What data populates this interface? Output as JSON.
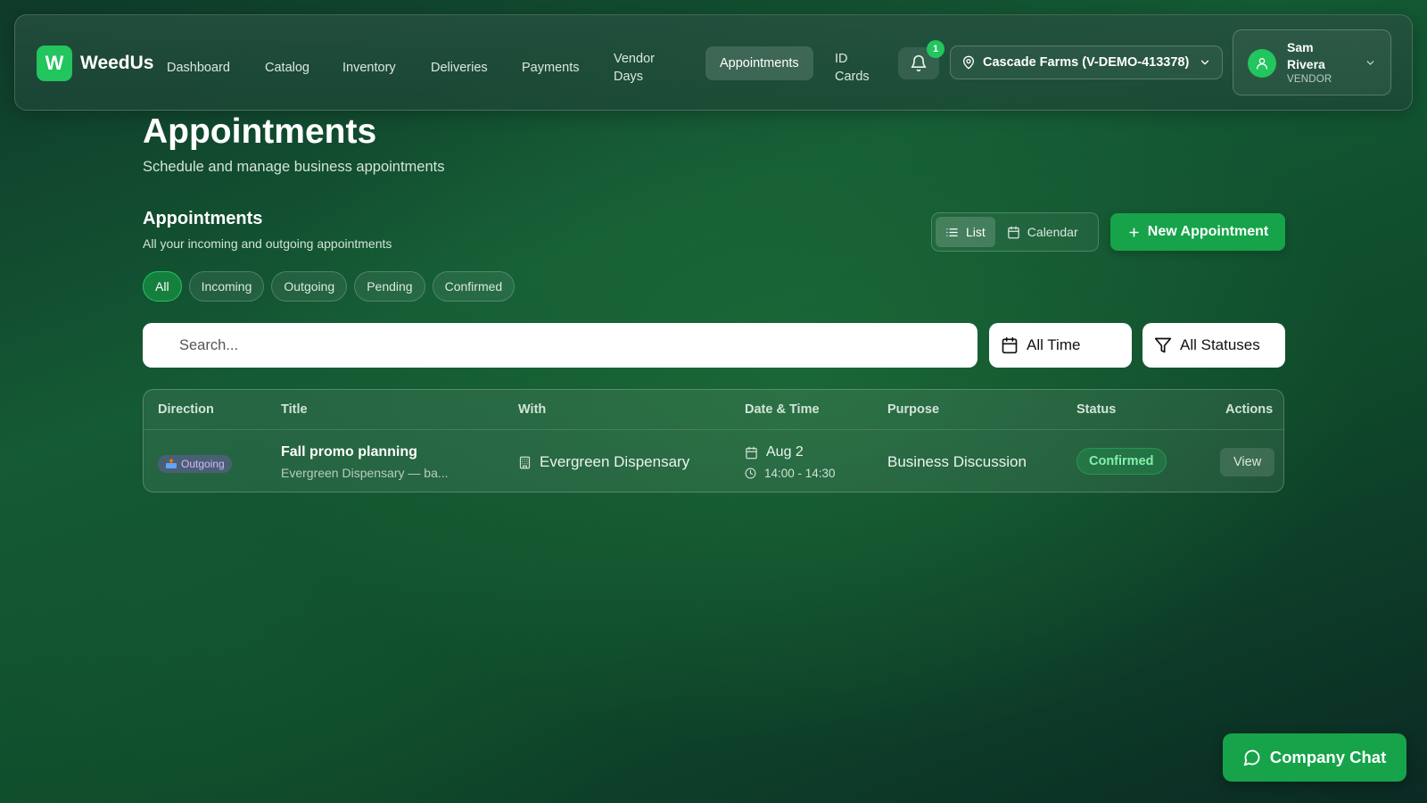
{
  "brand": {
    "logo_letter": "W",
    "name": "WeedUs",
    "color": "#22c55e"
  },
  "nav": {
    "items": [
      {
        "label": "Dashboard"
      },
      {
        "label": "Catalog"
      },
      {
        "label": "Inventory"
      },
      {
        "label": "Deliveries"
      },
      {
        "label": "Payments"
      },
      {
        "label": "Vendor Days"
      },
      {
        "label": "Appointments",
        "active": true
      },
      {
        "label": "ID Cards"
      }
    ],
    "notifications": {
      "icon": "bell-icon",
      "count": "1"
    },
    "location": {
      "icon": "map-pin-icon",
      "value": "Cascade Farms (V-DEMO-413378)"
    },
    "user": {
      "name": "Sam Rivera",
      "role": "VENDOR",
      "icon": "user-icon"
    }
  },
  "page": {
    "title": "Appointments",
    "subtitle": "Schedule and manage business appointments"
  },
  "section": {
    "title": "Appointments",
    "subtitle": "All your incoming and outgoing appointments",
    "view_toggle": {
      "list": "List",
      "calendar": "Calendar",
      "selected": "List"
    },
    "new_button": "New Appointment"
  },
  "filters": {
    "pills": [
      "All",
      "Incoming",
      "Outgoing",
      "Pending",
      "Confirmed"
    ],
    "selected": "All",
    "search_placeholder": "Search...",
    "time_filter": "All Time",
    "status_filter": "All Statuses"
  },
  "table": {
    "columns": [
      "Direction",
      "Title",
      "With",
      "Date & Time",
      "Purpose",
      "Status",
      "Actions"
    ],
    "rows": [
      {
        "direction": "Outgoing",
        "direction_icon": "outbox-tray-icon",
        "title": "Fall promo planning",
        "subtitle": "Evergreen Dispensary — ba...",
        "with": "Evergreen Dispensary",
        "with_icon": "building-icon",
        "date": "Aug 2",
        "time": "14:00 - 14:30",
        "purpose": "Business Discussion",
        "status": "Confirmed",
        "action": "View"
      }
    ]
  },
  "chat": {
    "label": "Company Chat",
    "icon": "chat-bubble-icon"
  },
  "colors": {
    "accent": "#16a34a",
    "status_confirmed": "#86efac",
    "outgoing_badge": "#d8b4fe"
  }
}
